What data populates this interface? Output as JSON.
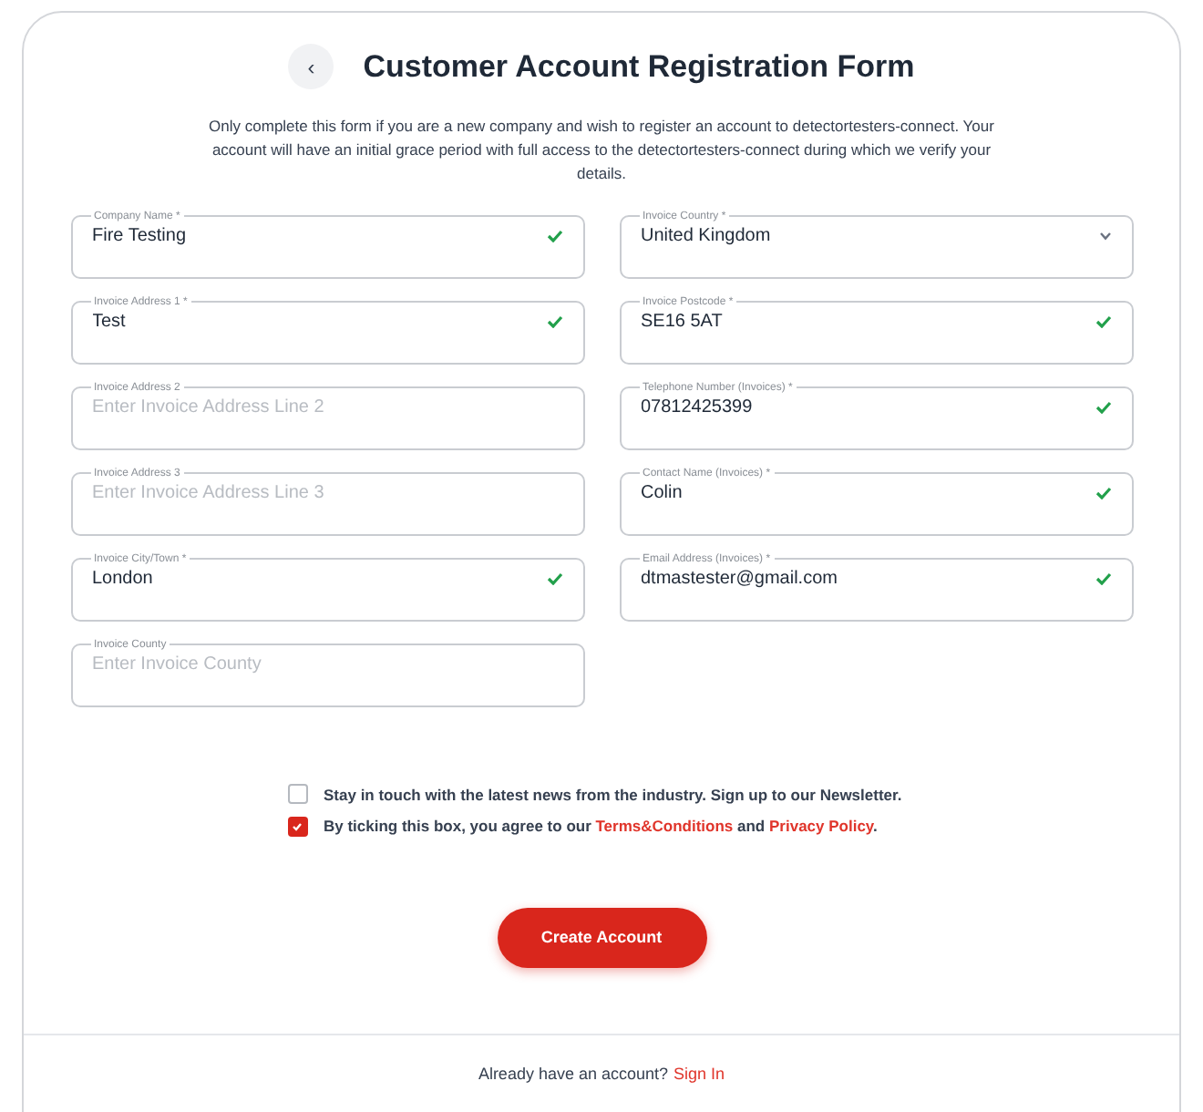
{
  "header": {
    "back_icon_label": "‹",
    "title": "Customer Account Registration Form"
  },
  "intro": "Only complete this form if you are a new company and wish to register an account to detectortesters-connect. Your account will have an initial grace period with full access to the detectortesters-connect during which we verify your details.",
  "columns": [
    {
      "fields": [
        {
          "kind": "text",
          "label": "Company Name *",
          "value": "Fire Testing",
          "valid": true
        },
        {
          "kind": "text",
          "label": "Invoice Address 1 *",
          "value": "Test",
          "valid": true
        },
        {
          "kind": "text",
          "label": "Invoice Address 2",
          "placeholder": "Enter Invoice Address Line 2",
          "valid": false
        },
        {
          "kind": "text",
          "label": "Invoice Address 3",
          "placeholder": "Enter Invoice Address Line 3",
          "valid": false
        },
        {
          "kind": "text",
          "label": "Invoice City/Town *",
          "value": "London",
          "valid": true
        },
        {
          "kind": "text",
          "label": "Invoice County",
          "placeholder": "Enter Invoice County",
          "valid": false
        }
      ]
    },
    {
      "fields": [
        {
          "kind": "select",
          "label": "Invoice Country *",
          "value": "United Kingdom",
          "valid": false
        },
        {
          "kind": "text",
          "label": "Invoice Postcode *",
          "value": "SE16 5AT",
          "valid": true
        },
        {
          "kind": "text",
          "label": "Telephone Number (Invoices) *",
          "value": "07812425399",
          "valid": true
        },
        {
          "kind": "text",
          "label": "Contact Name (Invoices) *",
          "value": "Colin",
          "valid": true
        },
        {
          "kind": "text",
          "label": "Email Address (Invoices) *",
          "value": "dtmastester@gmail.com",
          "valid": true
        }
      ]
    }
  ],
  "consents": [
    {
      "checked": false,
      "parts": [
        {
          "kind": "text",
          "text": "Stay in touch with the latest news from the industry. Sign up to our Newsletter."
        }
      ]
    },
    {
      "checked": true,
      "parts": [
        {
          "kind": "text",
          "text": "By ticking this box, you agree to our "
        },
        {
          "kind": "link",
          "text": "Terms&Conditions"
        },
        {
          "kind": "text",
          "text": " and "
        },
        {
          "kind": "link",
          "text": "Privacy Policy"
        },
        {
          "kind": "text",
          "text": "."
        }
      ]
    }
  ],
  "submit_button": "Create Account",
  "footer": {
    "text": "Already have an account?",
    "link": "Sign In"
  }
}
